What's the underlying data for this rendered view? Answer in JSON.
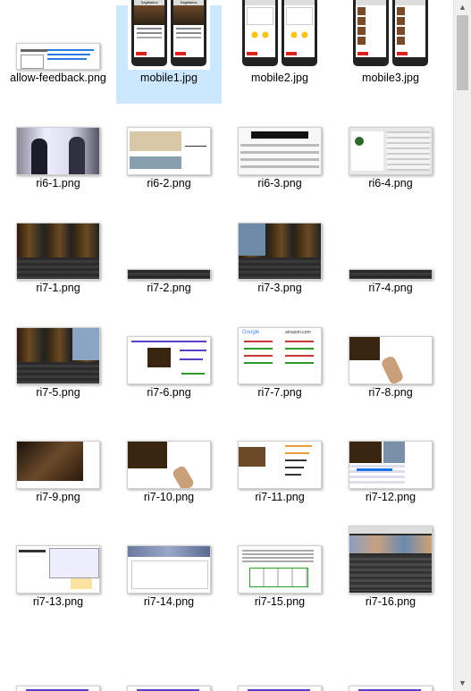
{
  "files": [
    {
      "name": "allow-feedback.png",
      "selected": false
    },
    {
      "name": "mobile1.jpg",
      "selected": true
    },
    {
      "name": "mobile2.jpg",
      "selected": false
    },
    {
      "name": "mobile3.jpg",
      "selected": false
    },
    {
      "name": "ri6-1.png",
      "selected": false
    },
    {
      "name": "ri6-2.png",
      "selected": false
    },
    {
      "name": "ri6-3.png",
      "selected": false
    },
    {
      "name": "ri6-4.png",
      "selected": false
    },
    {
      "name": "ri7-1.png",
      "selected": false
    },
    {
      "name": "ri7-2.png",
      "selected": false
    },
    {
      "name": "ri7-3.png",
      "selected": false
    },
    {
      "name": "ri7-4.png",
      "selected": false
    },
    {
      "name": "ri7-5.png",
      "selected": false
    },
    {
      "name": "ri7-6.png",
      "selected": false
    },
    {
      "name": "ri7-7.png",
      "selected": false
    },
    {
      "name": "ri7-8.png",
      "selected": false
    },
    {
      "name": "ri7-9.png",
      "selected": false
    },
    {
      "name": "ri7-10.png",
      "selected": false
    },
    {
      "name": "ri7-11.png",
      "selected": false
    },
    {
      "name": "ri7-12.png",
      "selected": false
    },
    {
      "name": "ri7-13.png",
      "selected": false
    },
    {
      "name": "ri7-14.png",
      "selected": false
    },
    {
      "name": "ri7-15.png",
      "selected": false
    },
    {
      "name": "ri7-16.png",
      "selected": false
    },
    {
      "name": "",
      "selected": false
    },
    {
      "name": "",
      "selected": false
    },
    {
      "name": "",
      "selected": false
    },
    {
      "name": "",
      "selected": false
    }
  ],
  "thumb_text": {
    "sagittarius": "Sagittarius",
    "google": "Google",
    "amazon": "amazon.com"
  },
  "scrollbar": {
    "up_icon": "scroll-up-arrow-icon",
    "down_icon": "scroll-down-arrow-icon"
  },
  "colors": {
    "selection": "#cce8ff",
    "scrollbar_thumb": "#c1c1c1"
  }
}
